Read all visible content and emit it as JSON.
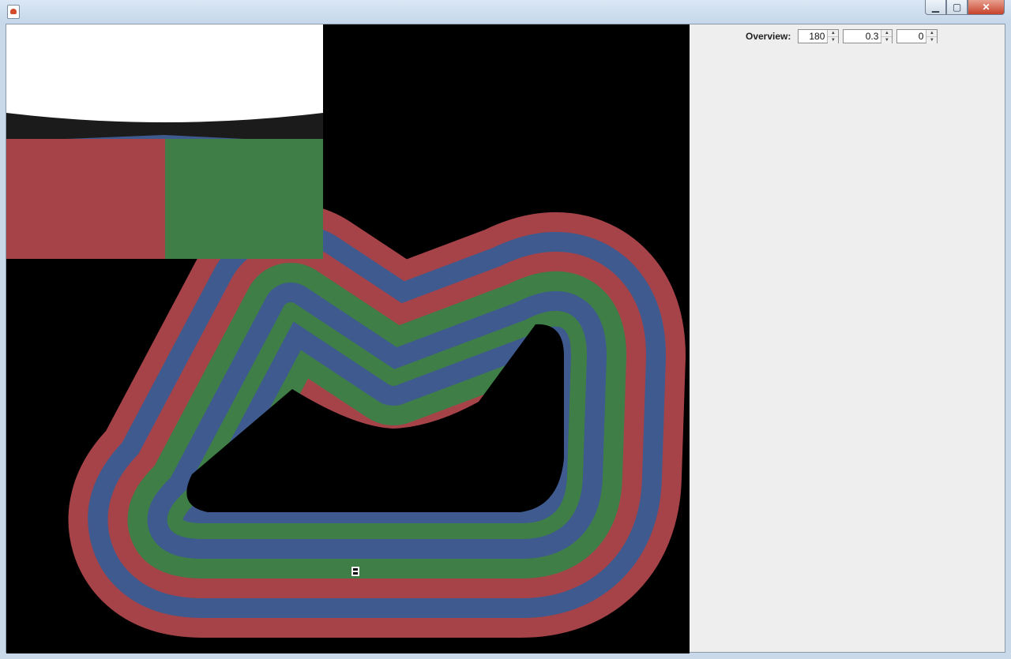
{
  "window": {
    "minimize_glyph": "▁",
    "maximize_glyph": "▢",
    "close_glyph": "✕",
    "icon": "java-app-icon"
  },
  "overview": {
    "label": "Overview:",
    "spinners": [
      {
        "value": "180",
        "up": "▲",
        "down": "▼"
      },
      {
        "value": "0.3",
        "up": "▲",
        "down": "▼"
      },
      {
        "value": "0",
        "up": "▲",
        "down": "▼"
      }
    ]
  },
  "track": {
    "lane_colors": [
      "#a54349",
      "#3e5a8f",
      "#3f7f47"
    ],
    "background": "#000000",
    "sky": "#ffffff",
    "wall": "#1b1b1b"
  }
}
